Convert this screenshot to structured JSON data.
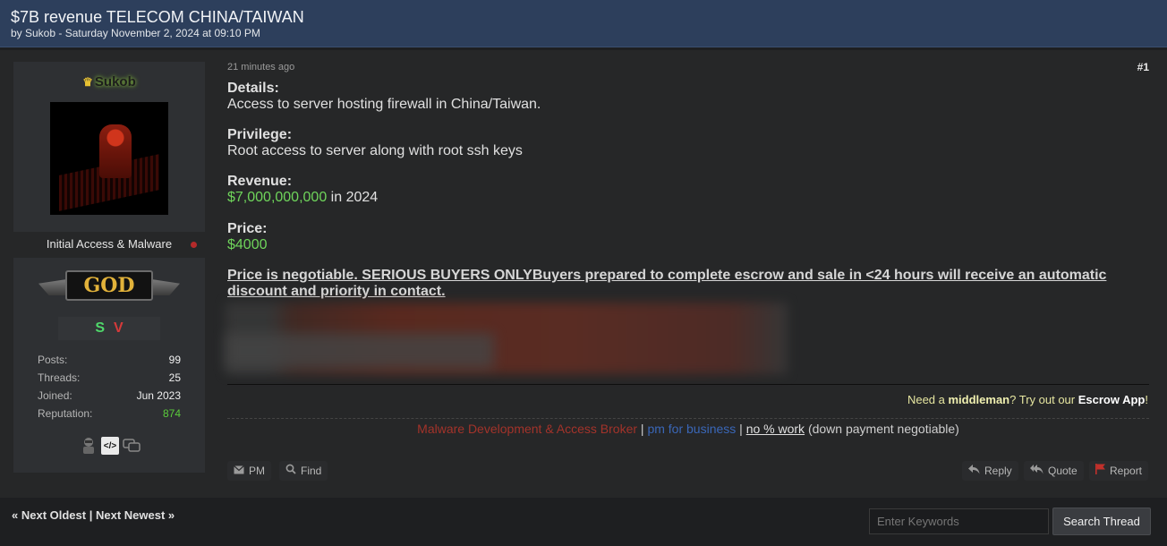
{
  "thread": {
    "title": "$7B revenue TELECOM CHINA/TAIWAN",
    "meta": "by Sukob - Saturday November 2, 2024 at 09:10 PM"
  },
  "author": {
    "username": "Sukob",
    "crown_icon": "crown-icon",
    "usertitle": "Initial Access & Malware",
    "rank_badge": "GOD",
    "badge_s": "S",
    "badge_v": "V",
    "stats": [
      {
        "label": "Posts:",
        "value": "99"
      },
      {
        "label": "Threads:",
        "value": "25"
      },
      {
        "label": "Joined:",
        "value": "Jun 2023"
      },
      {
        "label": "Reputation:",
        "value": "874"
      }
    ],
    "awards": [
      "hacker-award-icon",
      "code-award-icon",
      "chat-award-icon"
    ],
    "code_award_text": "</>"
  },
  "post": {
    "date": "21 minutes ago",
    "number": "#1",
    "details_h": "Details:",
    "details": "Access to server hosting firewall in China/Taiwan.",
    "privilege_h": "Privilege:",
    "privilege": "Root access to server along with root ssh keys",
    "revenue_h": "Revenue:",
    "revenue_amount": "$7,000,000,000",
    "revenue_suffix": " in 2024",
    "price_h": "Price:",
    "price": "$4000",
    "notice": "Price is negotiable. SERIOUS BUYERS ONLYBuyers prepared to complete escrow and sale in <24 hours will receive an automatic discount and priority in contact."
  },
  "escrow": {
    "pre": "Need a ",
    "middleman": "middleman",
    "mid": "? Try out our ",
    "app": "Escrow App",
    "post": "!"
  },
  "signature": {
    "part1": "Malware Development & Access Broker",
    "sep1": " | ",
    "part2": "pm for business",
    "sep2": " | ",
    "part3": "no % work",
    "part4": " (down payment negotiable)"
  },
  "buttons": {
    "pm": "PM",
    "find": "Find",
    "reply": "Reply",
    "quote": "Quote",
    "report": "Report"
  },
  "footer": {
    "next_oldest": "« Next Oldest",
    "sep": " | ",
    "next_newest": "Next Newest »",
    "search_placeholder": "Enter Keywords",
    "search_button": "Search Thread"
  }
}
